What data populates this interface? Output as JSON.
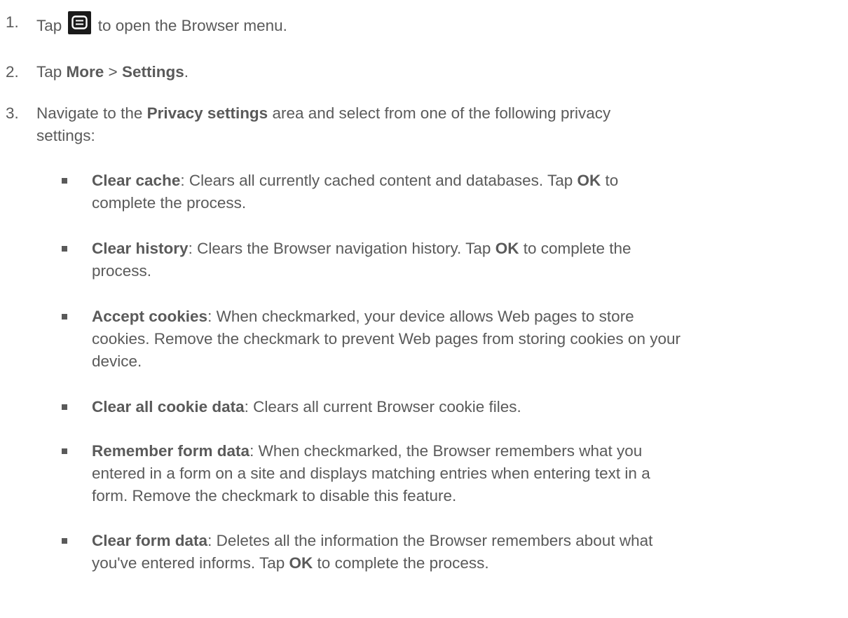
{
  "steps": [
    {
      "number": "1.",
      "before": "Tap ",
      "icon": "menu-key-icon",
      "after": " to open the Browser menu."
    },
    {
      "number": "2.",
      "prefix": "Tap ",
      "bold1": "More",
      "mid": " > ",
      "bold2": "Settings",
      "suffix": "."
    },
    {
      "number": "3.",
      "prefix": "Navigate to the ",
      "bold": "Privacy settings",
      "line1_rest": " area and select from one of the following privacy",
      "line2": "settings:"
    }
  ],
  "options": [
    {
      "term": "Clear cache",
      "line1": ": Clears all currently cached content and databases. Tap ",
      "ok": "OK",
      "line1_end": " to",
      "line2": "complete the process."
    },
    {
      "term": "Clear history",
      "line1": ": Clears the Browser navigation history. Tap ",
      "ok": "OK",
      "line1_end": " to complete the",
      "line2": "process."
    },
    {
      "term": "Accept cookies",
      "line1": ": When checkmarked, your device allows Web pages to store",
      "line2": "cookies. Remove the checkmark to prevent Web pages from storing cookies on your",
      "line3": "device."
    },
    {
      "term": "Clear all cookie data",
      "line1": ": Clears all current Browser cookie files."
    },
    {
      "term": "Remember form data",
      "line1": ": When checkmarked, the Browser remembers what you",
      "line2": "entered in a form on a site and displays matching entries when entering text in a",
      "line3": "form. Remove the checkmark to disable this feature."
    },
    {
      "term": "Clear form data",
      "line1": ": Deletes all the information the Browser remembers about what",
      "line2_start": "you've entered informs. Tap ",
      "ok": "OK",
      "line2_end": " to complete the process."
    }
  ]
}
